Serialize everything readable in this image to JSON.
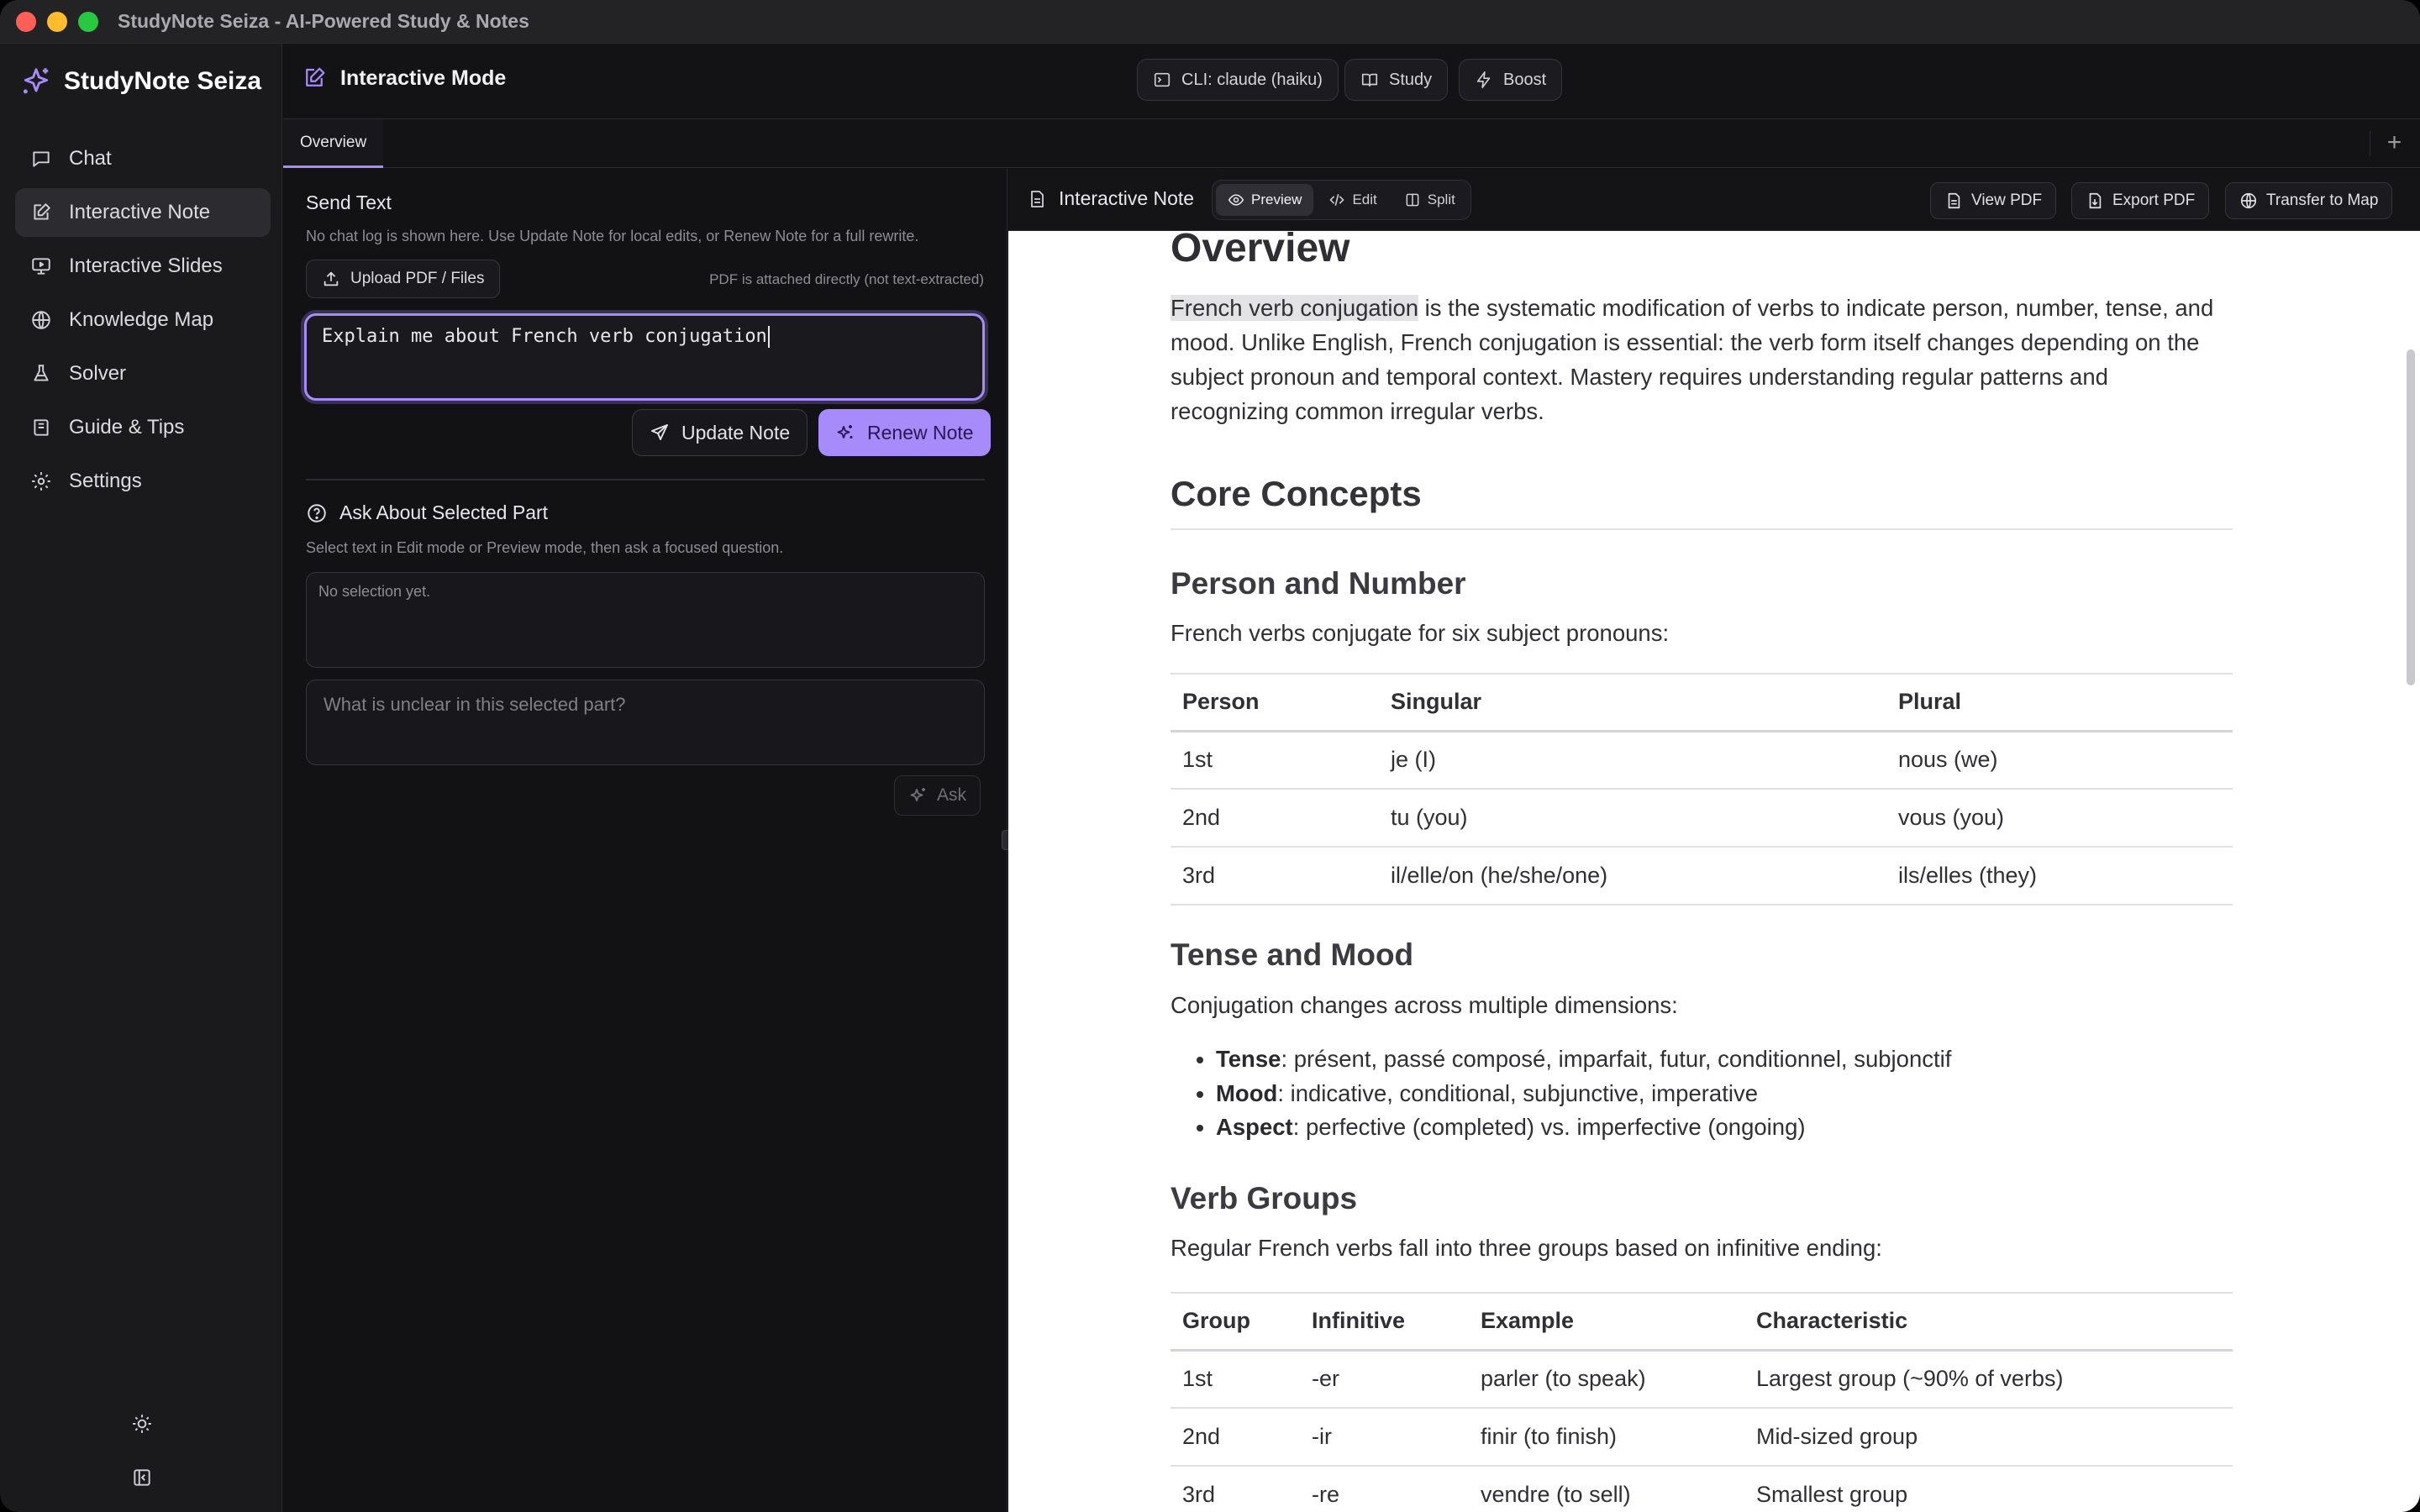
{
  "window": {
    "title": "StudyNote Seiza - AI-Powered Study & Notes"
  },
  "sidebar": {
    "brand": "StudyNote Seiza",
    "items": [
      {
        "label": "Chat",
        "icon": "chat-icon"
      },
      {
        "label": "Interactive Note",
        "icon": "note-edit-icon",
        "active": true
      },
      {
        "label": "Interactive Slides",
        "icon": "slides-icon"
      },
      {
        "label": "Knowledge Map",
        "icon": "globe-icon"
      },
      {
        "label": "Solver",
        "icon": "flask-icon"
      },
      {
        "label": "Guide & Tips",
        "icon": "book-icon"
      },
      {
        "label": "Settings",
        "icon": "gear-icon"
      }
    ]
  },
  "header": {
    "title": "Interactive Mode",
    "cli_label": "CLI: claude (haiku)",
    "study_label": "Study",
    "boost_label": "Boost"
  },
  "tabs": [
    {
      "label": "Overview",
      "active": true
    }
  ],
  "left": {
    "send_title": "Send Text",
    "send_hint": "No chat log is shown here. Use Update Note for local edits, or Renew Note for a full rewrite.",
    "upload_label": "Upload PDF / Files",
    "pdf_note": "PDF is attached directly (not text-extracted)",
    "prompt_value": "Explain me about French verb conjugation",
    "update_label": "Update Note",
    "renew_label": "Renew Note",
    "ask_title": "Ask About Selected Part",
    "ask_hint": "Select text in Edit mode or Preview mode, then ask a focused question.",
    "selection_text": "No selection yet.",
    "question_placeholder": "What is unclear in this selected part?",
    "ask_label": "Ask"
  },
  "doc_toolbar": {
    "name": "Interactive Note",
    "modes": [
      "Preview",
      "Edit",
      "Split"
    ],
    "active_mode": "Preview",
    "view_pdf": "View PDF",
    "export_pdf": "Export PDF",
    "transfer": "Transfer to Map"
  },
  "doc": {
    "h1": "Overview",
    "intro_highlight": "French verb conjugation",
    "intro_rest": " is the systematic modification of verbs to indicate person, number, tense, and mood. Unlike English, French conjugation is essential: the verb form itself changes depending on the subject pronoun and temporal context. Mastery requires understanding regular patterns and recognizing common irregular verbs.",
    "h2_core": "Core Concepts",
    "h3_person": "Person and Number",
    "person_intro": "French verbs conjugate for six subject pronouns:",
    "person_table": {
      "headers": [
        "Person",
        "Singular",
        "Plural"
      ],
      "rows": [
        [
          "1st",
          "je (I)",
          "nous (we)"
        ],
        [
          "2nd",
          "tu (you)",
          "vous (you)"
        ],
        [
          "3rd",
          "il/elle/on (he/she/one)",
          "ils/elles (they)"
        ]
      ]
    },
    "h3_tense": "Tense and Mood",
    "tense_intro": "Conjugation changes across multiple dimensions:",
    "bullets": [
      {
        "term": "Tense",
        "text": ": présent, passé composé, imparfait, futur, conditionnel, subjonctif"
      },
      {
        "term": "Mood",
        "text": ": indicative, conditional, subjunctive, imperative"
      },
      {
        "term": "Aspect",
        "text": ": perfective (completed) vs. imperfective (ongoing)"
      }
    ],
    "h3_groups": "Verb Groups",
    "groups_intro": "Regular French verbs fall into three groups based on infinitive ending:",
    "groups_table": {
      "headers": [
        "Group",
        "Infinitive",
        "Example",
        "Characteristic"
      ],
      "rows": [
        [
          "1st",
          "-er",
          "parler (to speak)",
          "Largest group (~90% of verbs)"
        ],
        [
          "2nd",
          "-ir",
          "finir (to finish)",
          "Mid-sized group"
        ],
        [
          "3rd",
          "-re",
          "vendre (to sell)",
          "Smallest group"
        ]
      ]
    }
  },
  "colors": {
    "accent": "#a78bfa",
    "bg": "#111114",
    "doc_bg": "#ffffff"
  }
}
